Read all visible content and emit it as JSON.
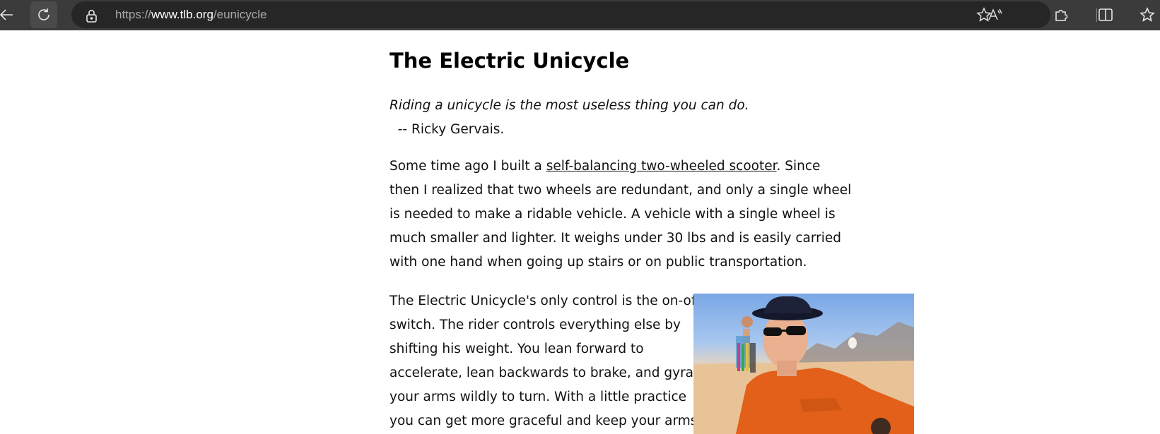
{
  "browser": {
    "url_prefix": "https://",
    "url_host": "www.tlb.org",
    "url_path": "/eunicycle",
    "read_aloud_label": "A⁾"
  },
  "article": {
    "title": "The Electric Unicycle",
    "quote": "Riding a unicycle is the most useless thing you can do.",
    "attribution": "  -- Ricky Gervais.",
    "para1": {
      "line1_before": "Some time ago I built a ",
      "line1_link": "self-balancing two-wheeled scooter",
      "line1_after": ". Since",
      "line2": "then I realized that two wheels are redundant, and only a single wheel",
      "line3": "is needed to make a ridable vehicle. A vehicle with a single wheel is",
      "line4": "much smaller and lighter. It weighs under 30 lbs and is easily carried",
      "line5": "with one hand when going up stairs or on public transportation."
    },
    "para2": {
      "lines": [
        "The Electric Unicycle's only control is the on-off",
        "switch. The rider controls everything else by",
        "shifting his weight. You lean forward to",
        "accelerate, lean backwards to brake, and gyrate",
        "your arms wildly to turn. With a little practice",
        "you can get more graceful and keep your arms"
      ]
    }
  },
  "icons": {
    "back": "back-arrow-icon",
    "refresh": "refresh-icon",
    "lock": "lock-icon",
    "read_aloud": "read-aloud-icon",
    "favorite": "star-icon",
    "extensions": "puzzle-piece-icon",
    "split_screen": "split-screen-icon",
    "favorites_bar": "favorites-icon"
  },
  "colors": {
    "toolbar_bg": "#3b3b3b",
    "address_bg": "#262626",
    "page_bg": "#ffffff"
  }
}
